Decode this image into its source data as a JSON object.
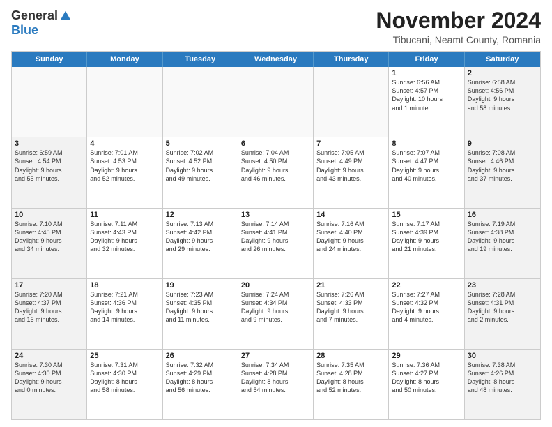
{
  "logo": {
    "general": "General",
    "blue": "Blue"
  },
  "header": {
    "month_title": "November 2024",
    "location": "Tibucani, Neamt County, Romania"
  },
  "days_of_week": [
    "Sunday",
    "Monday",
    "Tuesday",
    "Wednesday",
    "Thursday",
    "Friday",
    "Saturday"
  ],
  "rows": [
    [
      {
        "day": "",
        "info": ""
      },
      {
        "day": "",
        "info": ""
      },
      {
        "day": "",
        "info": ""
      },
      {
        "day": "",
        "info": ""
      },
      {
        "day": "",
        "info": ""
      },
      {
        "day": "1",
        "info": "Sunrise: 6:56 AM\nSunset: 4:57 PM\nDaylight: 10 hours\nand 1 minute."
      },
      {
        "day": "2",
        "info": "Sunrise: 6:58 AM\nSunset: 4:56 PM\nDaylight: 9 hours\nand 58 minutes."
      }
    ],
    [
      {
        "day": "3",
        "info": "Sunrise: 6:59 AM\nSunset: 4:54 PM\nDaylight: 9 hours\nand 55 minutes."
      },
      {
        "day": "4",
        "info": "Sunrise: 7:01 AM\nSunset: 4:53 PM\nDaylight: 9 hours\nand 52 minutes."
      },
      {
        "day": "5",
        "info": "Sunrise: 7:02 AM\nSunset: 4:52 PM\nDaylight: 9 hours\nand 49 minutes."
      },
      {
        "day": "6",
        "info": "Sunrise: 7:04 AM\nSunset: 4:50 PM\nDaylight: 9 hours\nand 46 minutes."
      },
      {
        "day": "7",
        "info": "Sunrise: 7:05 AM\nSunset: 4:49 PM\nDaylight: 9 hours\nand 43 minutes."
      },
      {
        "day": "8",
        "info": "Sunrise: 7:07 AM\nSunset: 4:47 PM\nDaylight: 9 hours\nand 40 minutes."
      },
      {
        "day": "9",
        "info": "Sunrise: 7:08 AM\nSunset: 4:46 PM\nDaylight: 9 hours\nand 37 minutes."
      }
    ],
    [
      {
        "day": "10",
        "info": "Sunrise: 7:10 AM\nSunset: 4:45 PM\nDaylight: 9 hours\nand 34 minutes."
      },
      {
        "day": "11",
        "info": "Sunrise: 7:11 AM\nSunset: 4:43 PM\nDaylight: 9 hours\nand 32 minutes."
      },
      {
        "day": "12",
        "info": "Sunrise: 7:13 AM\nSunset: 4:42 PM\nDaylight: 9 hours\nand 29 minutes."
      },
      {
        "day": "13",
        "info": "Sunrise: 7:14 AM\nSunset: 4:41 PM\nDaylight: 9 hours\nand 26 minutes."
      },
      {
        "day": "14",
        "info": "Sunrise: 7:16 AM\nSunset: 4:40 PM\nDaylight: 9 hours\nand 24 minutes."
      },
      {
        "day": "15",
        "info": "Sunrise: 7:17 AM\nSunset: 4:39 PM\nDaylight: 9 hours\nand 21 minutes."
      },
      {
        "day": "16",
        "info": "Sunrise: 7:19 AM\nSunset: 4:38 PM\nDaylight: 9 hours\nand 19 minutes."
      }
    ],
    [
      {
        "day": "17",
        "info": "Sunrise: 7:20 AM\nSunset: 4:37 PM\nDaylight: 9 hours\nand 16 minutes."
      },
      {
        "day": "18",
        "info": "Sunrise: 7:21 AM\nSunset: 4:36 PM\nDaylight: 9 hours\nand 14 minutes."
      },
      {
        "day": "19",
        "info": "Sunrise: 7:23 AM\nSunset: 4:35 PM\nDaylight: 9 hours\nand 11 minutes."
      },
      {
        "day": "20",
        "info": "Sunrise: 7:24 AM\nSunset: 4:34 PM\nDaylight: 9 hours\nand 9 minutes."
      },
      {
        "day": "21",
        "info": "Sunrise: 7:26 AM\nSunset: 4:33 PM\nDaylight: 9 hours\nand 7 minutes."
      },
      {
        "day": "22",
        "info": "Sunrise: 7:27 AM\nSunset: 4:32 PM\nDaylight: 9 hours\nand 4 minutes."
      },
      {
        "day": "23",
        "info": "Sunrise: 7:28 AM\nSunset: 4:31 PM\nDaylight: 9 hours\nand 2 minutes."
      }
    ],
    [
      {
        "day": "24",
        "info": "Sunrise: 7:30 AM\nSunset: 4:30 PM\nDaylight: 9 hours\nand 0 minutes."
      },
      {
        "day": "25",
        "info": "Sunrise: 7:31 AM\nSunset: 4:30 PM\nDaylight: 8 hours\nand 58 minutes."
      },
      {
        "day": "26",
        "info": "Sunrise: 7:32 AM\nSunset: 4:29 PM\nDaylight: 8 hours\nand 56 minutes."
      },
      {
        "day": "27",
        "info": "Sunrise: 7:34 AM\nSunset: 4:28 PM\nDaylight: 8 hours\nand 54 minutes."
      },
      {
        "day": "28",
        "info": "Sunrise: 7:35 AM\nSunset: 4:28 PM\nDaylight: 8 hours\nand 52 minutes."
      },
      {
        "day": "29",
        "info": "Sunrise: 7:36 AM\nSunset: 4:27 PM\nDaylight: 8 hours\nand 50 minutes."
      },
      {
        "day": "30",
        "info": "Sunrise: 7:38 AM\nSunset: 4:26 PM\nDaylight: 8 hours\nand 48 minutes."
      }
    ]
  ]
}
